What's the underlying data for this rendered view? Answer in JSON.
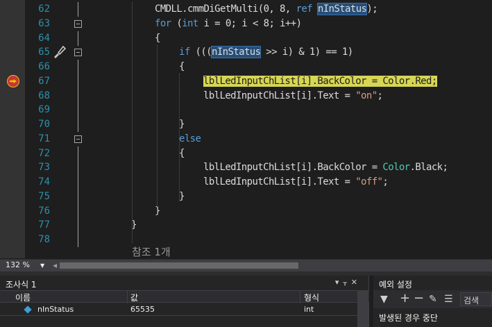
{
  "editor": {
    "lines": [
      {
        "n": "62",
        "tokens": [
          [
            "id",
            "CMDLL.cmmDiGetMulti(0, 8, "
          ],
          [
            "kw",
            "ref"
          ],
          [
            "id",
            " "
          ],
          [
            "hl",
            "nInStatus"
          ],
          [
            "id",
            ");"
          ]
        ],
        "indent": 92
      },
      {
        "n": "63",
        "tokens": [
          [
            "kw",
            "for"
          ],
          [
            "id",
            " ("
          ],
          [
            "kw",
            "int"
          ],
          [
            "id",
            " i = 0; i < 8; i++)"
          ]
        ],
        "indent": 92,
        "fold": true
      },
      {
        "n": "64",
        "tokens": [
          [
            "id",
            "{"
          ]
        ],
        "indent": 92
      },
      {
        "n": "65",
        "tokens": [
          [
            "kw",
            "if"
          ],
          [
            "id",
            " ((("
          ],
          [
            "hl",
            "nInStatus"
          ],
          [
            "id",
            " >> i) & 1) == 1)"
          ]
        ],
        "indent": 127,
        "fold": true
      },
      {
        "n": "66",
        "tokens": [
          [
            "id",
            "{"
          ]
        ],
        "indent": 127
      },
      {
        "n": "67",
        "tokens": [
          [
            "exec",
            "lblLedInputChList[i].BackColor = Color.Red;"
          ]
        ],
        "indent": 162
      },
      {
        "n": "68",
        "tokens": [
          [
            "id",
            "lblLedInputChList[i].Text = "
          ],
          [
            "str",
            "\"on\""
          ],
          [
            "id",
            ";"
          ]
        ],
        "indent": 162
      },
      {
        "n": "69",
        "tokens": [],
        "indent": 162
      },
      {
        "n": "70",
        "tokens": [
          [
            "id",
            "}"
          ]
        ],
        "indent": 127
      },
      {
        "n": "71",
        "tokens": [
          [
            "kw",
            "else"
          ]
        ],
        "indent": 127,
        "fold": true
      },
      {
        "n": "72",
        "tokens": [
          [
            "id",
            "{"
          ]
        ],
        "indent": 127
      },
      {
        "n": "73",
        "tokens": [
          [
            "id",
            "lblLedInputChList[i].BackColor = "
          ],
          [
            "typ",
            "Color"
          ],
          [
            "id",
            ".Black;"
          ]
        ],
        "indent": 162
      },
      {
        "n": "74",
        "tokens": [
          [
            "id",
            "lblLedInputChList[i].Text = "
          ],
          [
            "str",
            "\"off\""
          ],
          [
            "id",
            ";"
          ]
        ],
        "indent": 162
      },
      {
        "n": "75",
        "tokens": [
          [
            "id",
            "}"
          ]
        ],
        "indent": 127
      },
      {
        "n": "76",
        "tokens": [
          [
            "id",
            "}"
          ]
        ],
        "indent": 92
      },
      {
        "n": "77",
        "tokens": [
          [
            "id",
            "}"
          ]
        ],
        "indent": 58
      },
      {
        "n": "78",
        "tokens": [],
        "indent": 58
      }
    ],
    "reference_lens": "참조 1개",
    "breakpoint_icon": "current-statement-breakpoint-icon",
    "brush_icon": "quick-actions-brush-icon"
  },
  "zoom": {
    "level": "132 %"
  },
  "watch": {
    "title": "조사식 1",
    "controls": "▾ ᚁ ✕",
    "columns": [
      "이름",
      "값",
      "형식"
    ],
    "rows": [
      {
        "name": "nInStatus",
        "value": "65535",
        "type": "int"
      }
    ]
  },
  "exceptions": {
    "title": "예외 설정",
    "search_placeholder": "검색",
    "items": [
      "발생된 경우 중단"
    ]
  },
  "colors": {
    "keyword": "#569cd6",
    "string": "#d69d85",
    "type": "#4ec9b0",
    "line_number": "#2b91af",
    "current_statement": "#d6d654",
    "highlight": "#264f78"
  }
}
